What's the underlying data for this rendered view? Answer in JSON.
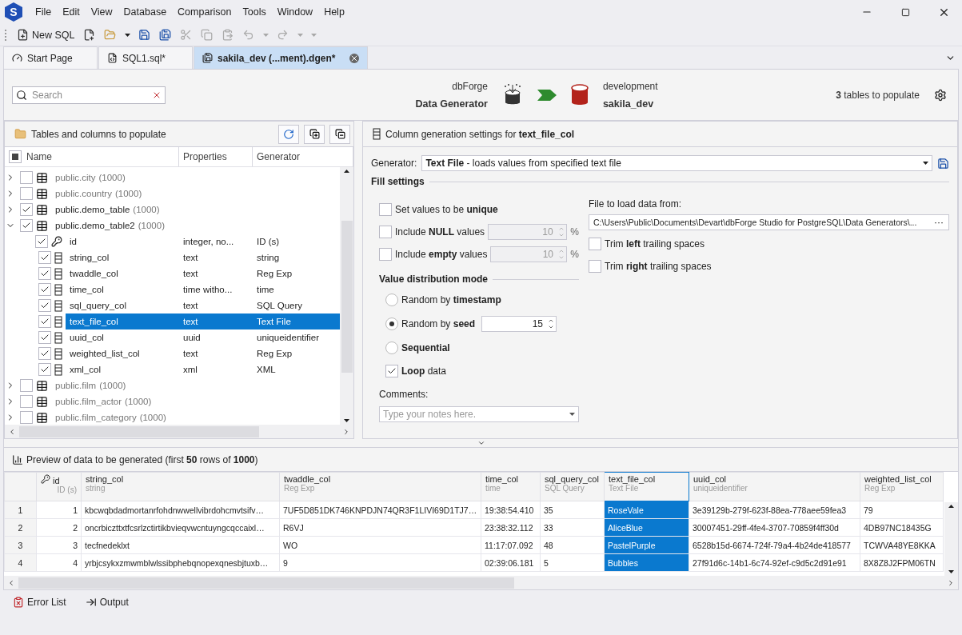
{
  "app": {
    "logo": "S"
  },
  "menu": [
    "File",
    "Edit",
    "View",
    "Database",
    "Comparison",
    "Tools",
    "Window",
    "Help"
  ],
  "toolbar": [
    {
      "kind": "new-sql",
      "label": "New SQL",
      "disabled": false
    },
    {
      "kind": "new-file",
      "disabled": false
    },
    {
      "kind": "open",
      "disabled": false
    },
    {
      "kind": "dropdown",
      "disabled": false
    },
    {
      "kind": "save",
      "disabled": false
    },
    {
      "kind": "save-all",
      "disabled": false
    },
    {
      "kind": "cut",
      "disabled": true
    },
    {
      "kind": "copy",
      "disabled": true
    },
    {
      "kind": "paste",
      "disabled": true
    },
    {
      "kind": "undo",
      "disabled": true
    },
    {
      "kind": "dropdown",
      "disabled": true
    },
    {
      "kind": "redo",
      "disabled": true
    },
    {
      "kind": "dropdown",
      "disabled": true
    },
    {
      "kind": "dropdown",
      "disabled": true
    }
  ],
  "tabs": [
    {
      "kind": "start",
      "label": "Start Page",
      "selected": false
    },
    {
      "kind": "sql",
      "label": "SQL1.sql*",
      "selected": false
    },
    {
      "kind": "dgen",
      "label": "sakila_dev (...ment).dgen*",
      "selected": true
    }
  ],
  "header": {
    "search_placeholder": "Search",
    "source": {
      "line1": "dbForge",
      "line2": "Data Generator"
    },
    "target": {
      "line1": "development",
      "line2": "sakila_dev"
    },
    "summary": "**3** tables to populate"
  },
  "tree": {
    "title": "Tables and columns to populate",
    "header_checkbox": {
      "indeterminate": true
    },
    "columns": [
      "Name",
      "Properties",
      "Generator"
    ],
    "tables": [
      {
        "name": "public.city",
        "count": "(1000)",
        "checked": false,
        "expanded": false
      },
      {
        "name": "public.country",
        "count": "(1000)",
        "checked": false,
        "expanded": false
      },
      {
        "name": "public.demo_table",
        "count": "(1000)",
        "checked": true,
        "expanded": false
      },
      {
        "name": "public.demo_table2",
        "count": "(1000)",
        "checked": true,
        "expanded": true,
        "children": [
          {
            "kind": "key",
            "name": "id",
            "properties": "integer, no...",
            "generator": "ID (s)",
            "checked": true,
            "selected": false
          },
          {
            "kind": "column",
            "name": "string_col",
            "properties": "text",
            "generator": "string",
            "checked": true,
            "selected": false
          },
          {
            "kind": "column",
            "name": "twaddle_col",
            "properties": "text",
            "generator": "Reg Exp",
            "checked": true,
            "selected": false
          },
          {
            "kind": "column",
            "name": "time_col",
            "properties": "time witho...",
            "generator": "time",
            "checked": true,
            "selected": false
          },
          {
            "kind": "column",
            "name": "sql_query_col",
            "properties": "text",
            "generator": "SQL Query",
            "checked": true,
            "selected": false
          },
          {
            "kind": "column",
            "name": "text_file_col",
            "properties": "text",
            "generator": "Text File",
            "checked": true,
            "selected": true
          },
          {
            "kind": "column",
            "name": "uuid_col",
            "properties": "uuid",
            "generator": "uniqueidentifier",
            "checked": true,
            "selected": false
          },
          {
            "kind": "column",
            "name": "weighted_list_col",
            "properties": "text",
            "generator": "Reg Exp",
            "checked": true,
            "selected": false
          },
          {
            "kind": "column",
            "name": "xml_col",
            "properties": "xml",
            "generator": "XML",
            "checked": true,
            "selected": false
          }
        ]
      },
      {
        "name": "public.film",
        "count": "(1000)",
        "checked": false,
        "expanded": false
      },
      {
        "name": "public.film_actor",
        "count": "(1000)",
        "checked": false,
        "expanded": false
      },
      {
        "name": "public.film_category",
        "count": "(1000)",
        "checked": false,
        "expanded": false
      }
    ]
  },
  "settings": {
    "title": "Column generation settings for **text_file_col**",
    "generator_label": "Generator:",
    "generator_value": "**Text File** - loads values from specified text file",
    "fill_heading": "Fill settings",
    "options": [
      {
        "kind": "check",
        "label": "Set values to be **unique**",
        "checked": false
      },
      {
        "kind": "spin",
        "label": "Include **NULL** values",
        "checked": false,
        "value": "10",
        "unit": "%"
      },
      {
        "kind": "spin",
        "label": "Include **empty** values",
        "checked": false,
        "value": "10",
        "unit": "%"
      }
    ],
    "distribution_heading": "Value distribution mode",
    "modes": [
      {
        "label": "Random by **timestamp**",
        "selected": false,
        "bold": false
      },
      {
        "label": "Random by **seed**",
        "selected": true,
        "bold": false,
        "value": "15"
      },
      {
        "label": "Sequential",
        "selected": false,
        "bold": true
      }
    ],
    "loop": {
      "label": "**Loop** data",
      "checked": true
    },
    "comments_label": "Comments:",
    "comments_placeholder": "Type your notes here.",
    "file_label": "File to load data from:",
    "file_path": "C:\\Users\\Public\\Documents\\Devart\\dbForge Studio for PostgreSQL\\Data Generators\\...",
    "browse_button": "···",
    "trims": [
      {
        "label": "Trim **left** trailing spaces",
        "checked": false
      },
      {
        "label": "Trim **right** trailing spaces",
        "checked": false
      }
    ]
  },
  "preview": {
    "title": "Preview of data to be generated (first **50** rows of **1000**)",
    "columns": [
      {
        "kind": "key",
        "name": "id",
        "generator": "ID (s)",
        "selected": false
      },
      {
        "kind": "column",
        "name": "string_col",
        "generator": "string",
        "selected": false
      },
      {
        "kind": "column",
        "name": "twaddle_col",
        "generator": "Reg Exp",
        "selected": false
      },
      {
        "kind": "column",
        "name": "time_col",
        "generator": "time",
        "selected": false
      },
      {
        "kind": "column",
        "name": "sql_query_col",
        "generator": "SQL Query",
        "selected": false
      },
      {
        "kind": "column",
        "name": "text_file_col",
        "generator": "Text File",
        "selected": true
      },
      {
        "kind": "column",
        "name": "uuid_col",
        "generator": "uniqueidentifier",
        "selected": false
      },
      {
        "kind": "column",
        "name": "weighted_list_col",
        "generator": "Reg Exp",
        "selected": false
      }
    ],
    "rows": [
      {
        "number": "1",
        "cells": [
          "1",
          "kbcwqbdadmortanrfohdnwwellvibrdohcmvtsifv…",
          "7UF5D851DK746KNPDJN74QR3F1LIVI69D1TJ7…",
          "19:38:54.410",
          "35",
          "RoseVale",
          "3e39129b-279f-623f-88ea-778aee59fea3",
          "79"
        ]
      },
      {
        "number": "2",
        "cells": [
          "2",
          "oncrbiczttxtfcsrlzctirtikbvieqvwcntuyngcqccaixl…",
          "R6VJ",
          "23:38:32.112",
          "33",
          "AliceBlue",
          "30007451-29ff-4fe4-3707-70859f4ff30d",
          "4DB97NC18435G"
        ]
      },
      {
        "number": "3",
        "cells": [
          "3",
          "tecfnedeklxt",
          "WO",
          "11:17:07.092",
          "48",
          "PastelPurple",
          "6528b15d-6674-724f-79a4-4b24de418577",
          "TCWVA48YE8KKA"
        ]
      },
      {
        "number": "4",
        "cells": [
          "4",
          "yrbjcsykxzmwmblwlssibphebqnopexqnesbjtuxb…",
          "9",
          "02:39:06.181",
          "5",
          "Bubbles",
          "27f91d6c-14b1-6c74-92ef-c9d5c2d91e91",
          "8X8Z8J2FPM06TN"
        ]
      }
    ]
  },
  "bottom_tabs": [
    {
      "kind": "errors",
      "label": "Error List"
    },
    {
      "kind": "output",
      "label": "Output"
    }
  ]
}
